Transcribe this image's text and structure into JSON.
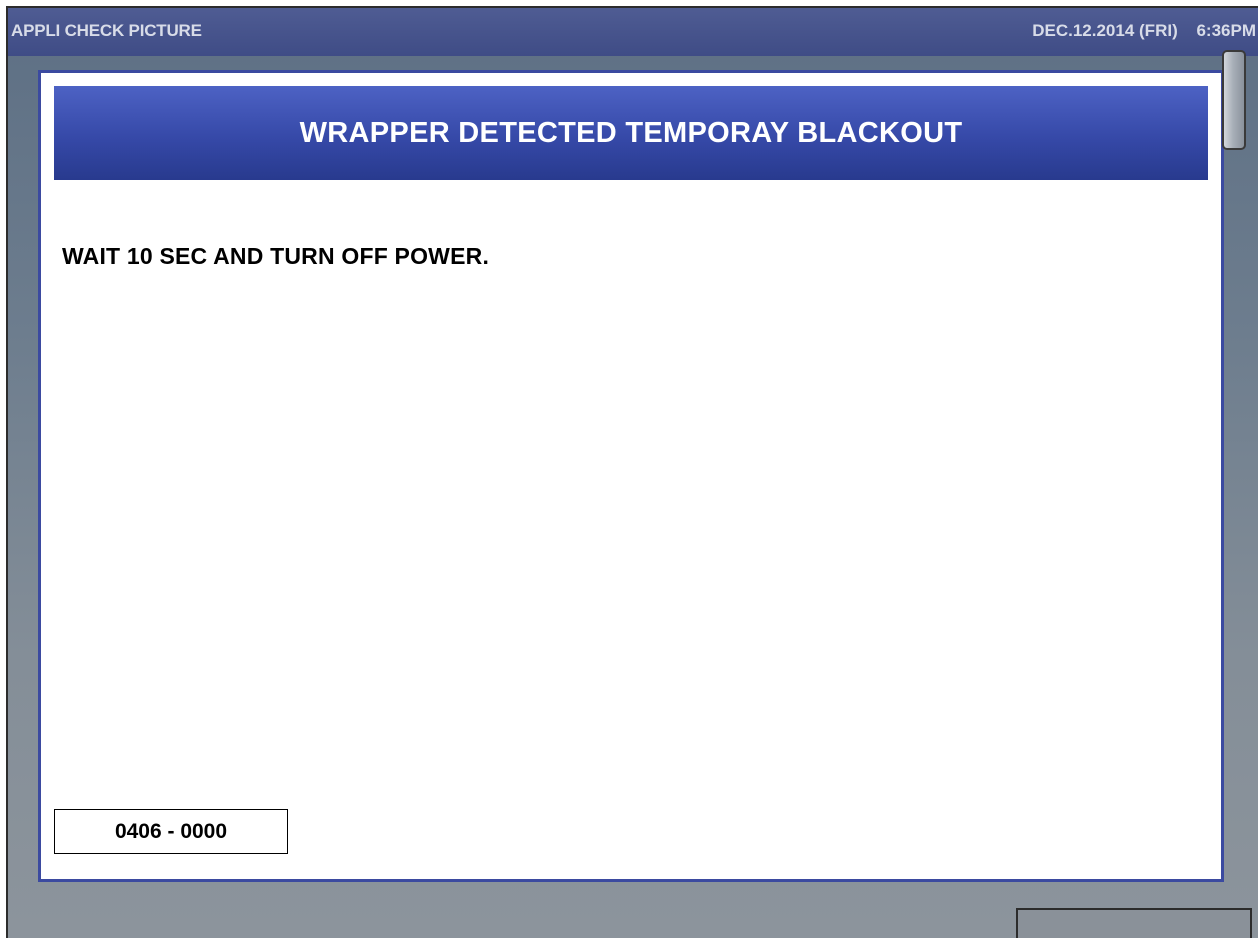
{
  "topbar": {
    "title": "APPLI CHECK PICTURE",
    "date": "DEC.12.2014 (FRI)",
    "time": "6:36PM"
  },
  "dialog": {
    "title": "WRAPPER DETECTED TEMPORAY BLACKOUT",
    "message": "WAIT 10 SEC AND TURN OFF POWER.",
    "code": "0406 - 0000"
  },
  "colors": {
    "topbar": "#4a5790",
    "header_blue": "#3649a8",
    "dialog_border": "#3b4aa0",
    "background": "#76828f"
  }
}
